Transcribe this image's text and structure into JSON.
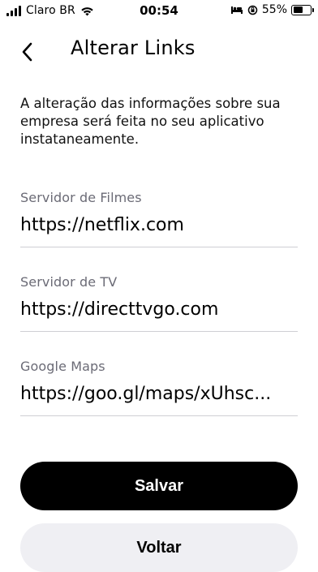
{
  "status_bar": {
    "carrier": "Claro BR",
    "time": "00:54",
    "battery_percent": "55%"
  },
  "nav": {
    "title": "Alterar Links"
  },
  "description": "A alteração das informações sobre sua empresa será feita no seu aplicativo instataneamente.",
  "fields": [
    {
      "label": "Servidor de Filmes",
      "value": "https://netflix.com"
    },
    {
      "label": "Servidor de TV",
      "value": "https://directtvgo.com"
    },
    {
      "label": "Google Maps",
      "value": "https://goo.gl/maps/xUhsc..."
    }
  ],
  "buttons": {
    "save_label": "Salvar",
    "back_label": "Voltar"
  },
  "colors": {
    "primary": "#000000",
    "secondary_bg": "#efeff3",
    "label": "#6b6b76"
  }
}
